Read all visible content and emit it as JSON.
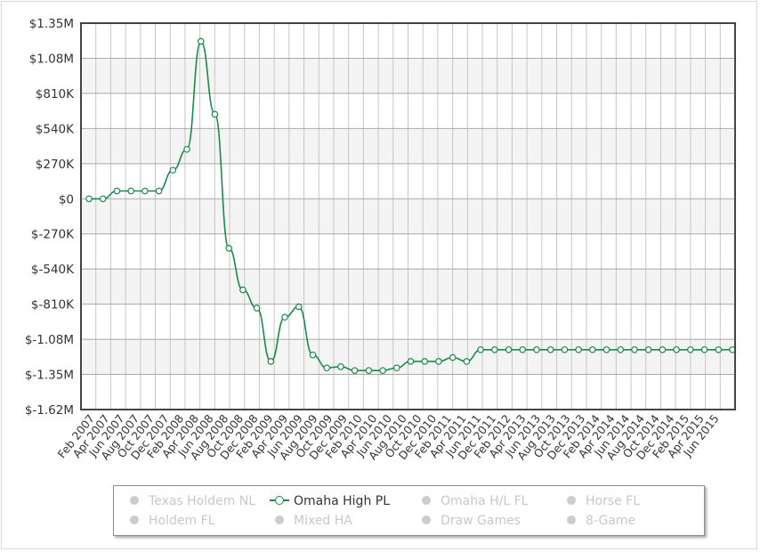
{
  "chart_data": {
    "type": "line",
    "y_tick_labels": [
      "$1.35M",
      "$1.08M",
      "$810K",
      "$540K",
      "$270K",
      "$0",
      "$-270K",
      "$-540K",
      "$-810K",
      "$-1.08M",
      "$-1.35M",
      "$-1.62M"
    ],
    "ylim": [
      -1620000,
      1350000
    ],
    "x_tick_labels": [
      "Feb 2007",
      "Apr 2007",
      "Jun 2007",
      "Aug 2007",
      "Oct 2007",
      "Dec 2007",
      "Feb 2008",
      "Apr 2008",
      "Jun 2008",
      "Aug 2008",
      "Oct 2008",
      "Dec 2008",
      "Feb 2009",
      "Apr 2009",
      "Jun 2009",
      "Aug 2009",
      "Oct 2009",
      "Dec 2009",
      "Feb 2010",
      "Apr 2010",
      "Jun 2010",
      "Aug 2010",
      "Oct 2010",
      "Dec 2010",
      "Feb 2011",
      "Apr 2011",
      "Jun 2011",
      "Aug 2011",
      "Oct 2011",
      "Dec 2011",
      "Feb 2012",
      "Apr 2012",
      "Jun 2012",
      "Aug 2012",
      "Oct 2012",
      "Dec 2012",
      "Feb 2013",
      "Apr 2013",
      "Jun 2013",
      "Aug 2013",
      "Oct 2013",
      "Dec 2013",
      "Feb 2014",
      "Apr 2014",
      "Jun 2014",
      "Aug 2014",
      "Oct 2014",
      "Dec 2014",
      "Feb 2015",
      "Apr 2015",
      "Jun 2015"
    ],
    "x_axis_shown_labels": [
      "Feb 2007",
      "Apr 2007",
      "Jun 2007",
      "Aug 2007",
      "Oct 2007",
      "Dec 2007",
      "Feb 2008",
      "Apr 2008",
      "Jun 2008",
      "Aug 2008",
      "Oct 2008",
      "Dec 2008",
      "Feb 2009",
      "Apr 2009",
      "Jun 2009",
      "Aug 2009",
      "Oct 2009",
      "Dec 2009",
      "Feb 2010",
      "Apr 2010",
      "Jun 2010",
      "Aug 2010",
      "Oct 2010",
      "Dec 2010",
      "Feb 2011",
      "Apr 2011",
      "Jun 2011",
      "Dec 2011",
      "Feb 2012",
      "Apr 2013",
      "Jun 2013",
      "Aug 2013",
      "Oct 2013",
      "Dec 2013",
      "Feb 2014",
      "Apr 2014",
      "Jun 2014",
      "Aug 2014",
      "Oct 2014",
      "Dec 2014",
      "Feb 2015",
      "Apr 2015",
      "Jun 2015"
    ],
    "grid": true,
    "series": [
      {
        "name": "Omaha High PL",
        "color": "#1a8a4a",
        "values": [
          [
            0,
            0
          ],
          [
            1,
            0
          ],
          [
            2,
            60000
          ],
          [
            3,
            60000
          ],
          [
            4,
            60000
          ],
          [
            5,
            60000
          ],
          [
            6,
            220000
          ],
          [
            7,
            380000
          ],
          [
            8,
            1210000
          ],
          [
            9,
            650000
          ],
          [
            10,
            -380000
          ],
          [
            11,
            -700000
          ],
          [
            12,
            -840000
          ],
          [
            13,
            -1250000
          ],
          [
            14,
            -910000
          ],
          [
            15,
            -830000
          ],
          [
            16,
            -1200000
          ],
          [
            17,
            -1300000
          ],
          [
            18,
            -1290000
          ],
          [
            19,
            -1320000
          ],
          [
            20,
            -1320000
          ],
          [
            21,
            -1320000
          ],
          [
            22,
            -1300000
          ],
          [
            23,
            -1250000
          ],
          [
            24,
            -1250000
          ],
          [
            25,
            -1250000
          ],
          [
            26,
            -1220000
          ],
          [
            27,
            -1250000
          ],
          [
            28,
            -1160000
          ],
          [
            29,
            -1160000
          ],
          [
            30,
            -1160000
          ],
          [
            31,
            -1160000
          ],
          [
            32,
            -1160000
          ],
          [
            33,
            -1160000
          ],
          [
            34,
            -1160000
          ],
          [
            35,
            -1160000
          ],
          [
            36,
            -1160000
          ],
          [
            37,
            -1160000
          ],
          [
            38,
            -1160000
          ],
          [
            39,
            -1160000
          ],
          [
            40,
            -1160000
          ],
          [
            41,
            -1160000
          ],
          [
            42,
            -1160000
          ],
          [
            43,
            -1160000
          ],
          [
            44,
            -1160000
          ],
          [
            45,
            -1160000
          ],
          [
            46,
            -1160000
          ]
        ]
      }
    ]
  },
  "legend": {
    "items": [
      {
        "label": "Texas Holdem NL",
        "visible": false
      },
      {
        "label": "Omaha High PL",
        "visible": true
      },
      {
        "label": "Omaha H/L FL",
        "visible": false
      },
      {
        "label": "Horse FL",
        "visible": false
      },
      {
        "label": "Holdem FL",
        "visible": false
      },
      {
        "label": "Mixed HA",
        "visible": false
      },
      {
        "label": "Draw Games",
        "visible": false
      },
      {
        "label": "8-Game",
        "visible": false
      }
    ]
  }
}
